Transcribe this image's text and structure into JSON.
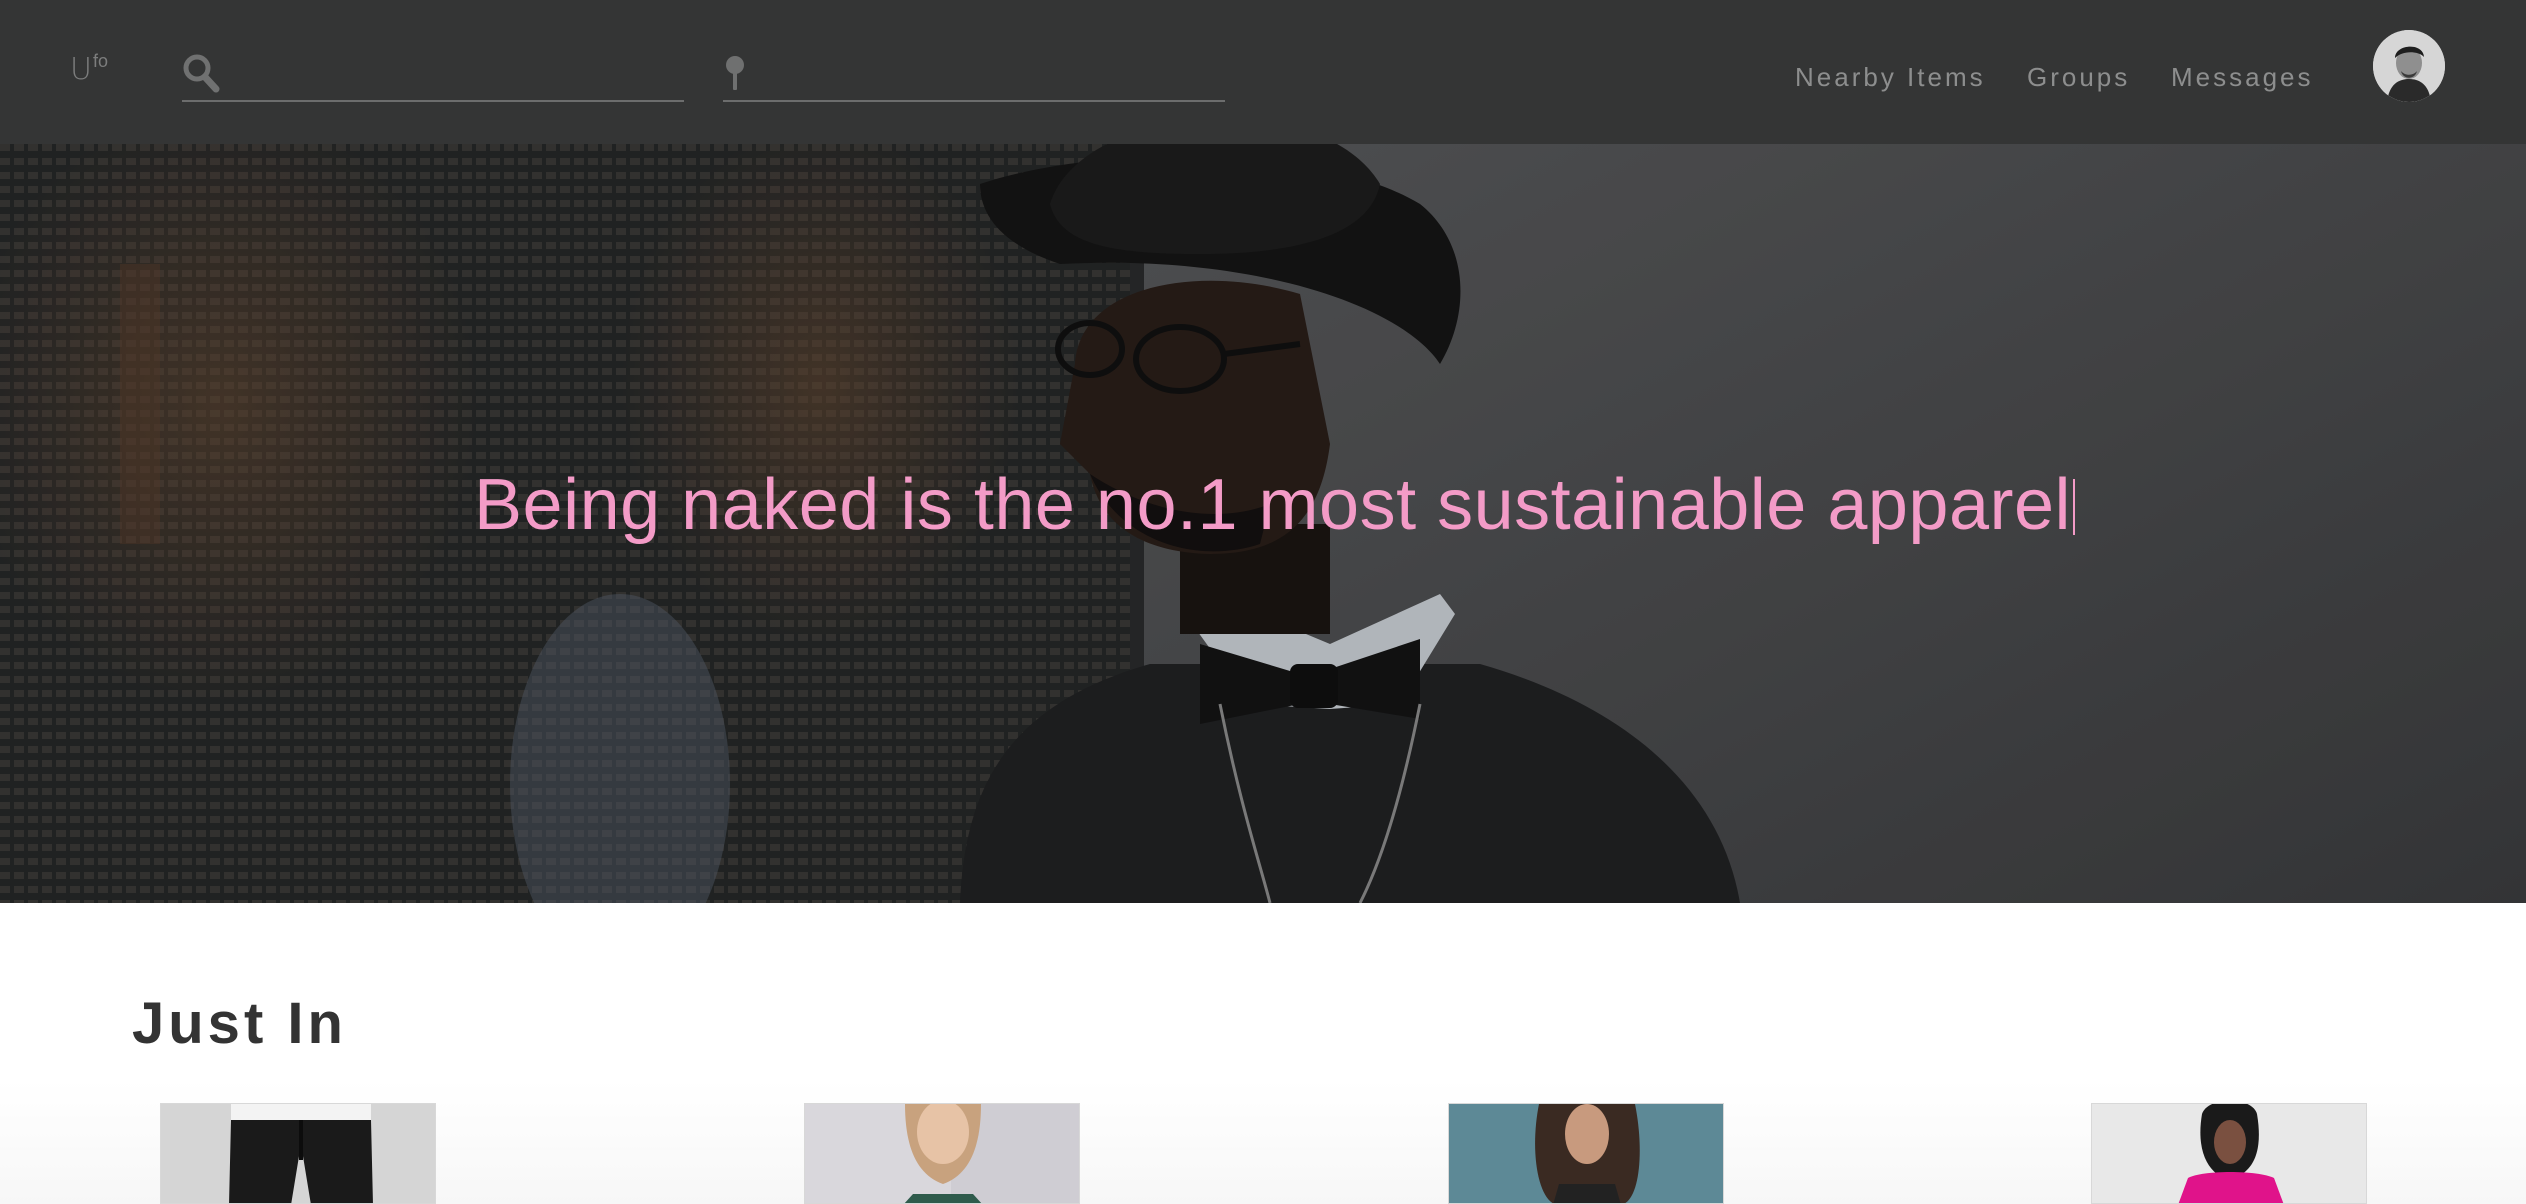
{
  "header": {
    "logo_main": "U",
    "logo_sup": "fo",
    "search": {
      "placeholder": "",
      "value": "",
      "icon": "search-icon"
    },
    "location": {
      "placeholder": "",
      "value": "",
      "icon": "map-pin-icon"
    },
    "nav": [
      {
        "label": "Nearby Items"
      },
      {
        "label": "Groups"
      },
      {
        "label": "Messages"
      }
    ],
    "avatar_icon": "user-avatar"
  },
  "hero": {
    "headline": "Being naked is the no.1 most sustainable apparel",
    "headline_color": "#f39bc7"
  },
  "just_in": {
    "title": "Just In",
    "products": [
      {
        "name": "black jeans"
      },
      {
        "name": "green dress"
      },
      {
        "name": "patterned top"
      },
      {
        "name": "pink blouse"
      }
    ]
  },
  "colors": {
    "navbar": "#343535",
    "nav_text": "#8d8e8e",
    "title_text": "#333333"
  }
}
